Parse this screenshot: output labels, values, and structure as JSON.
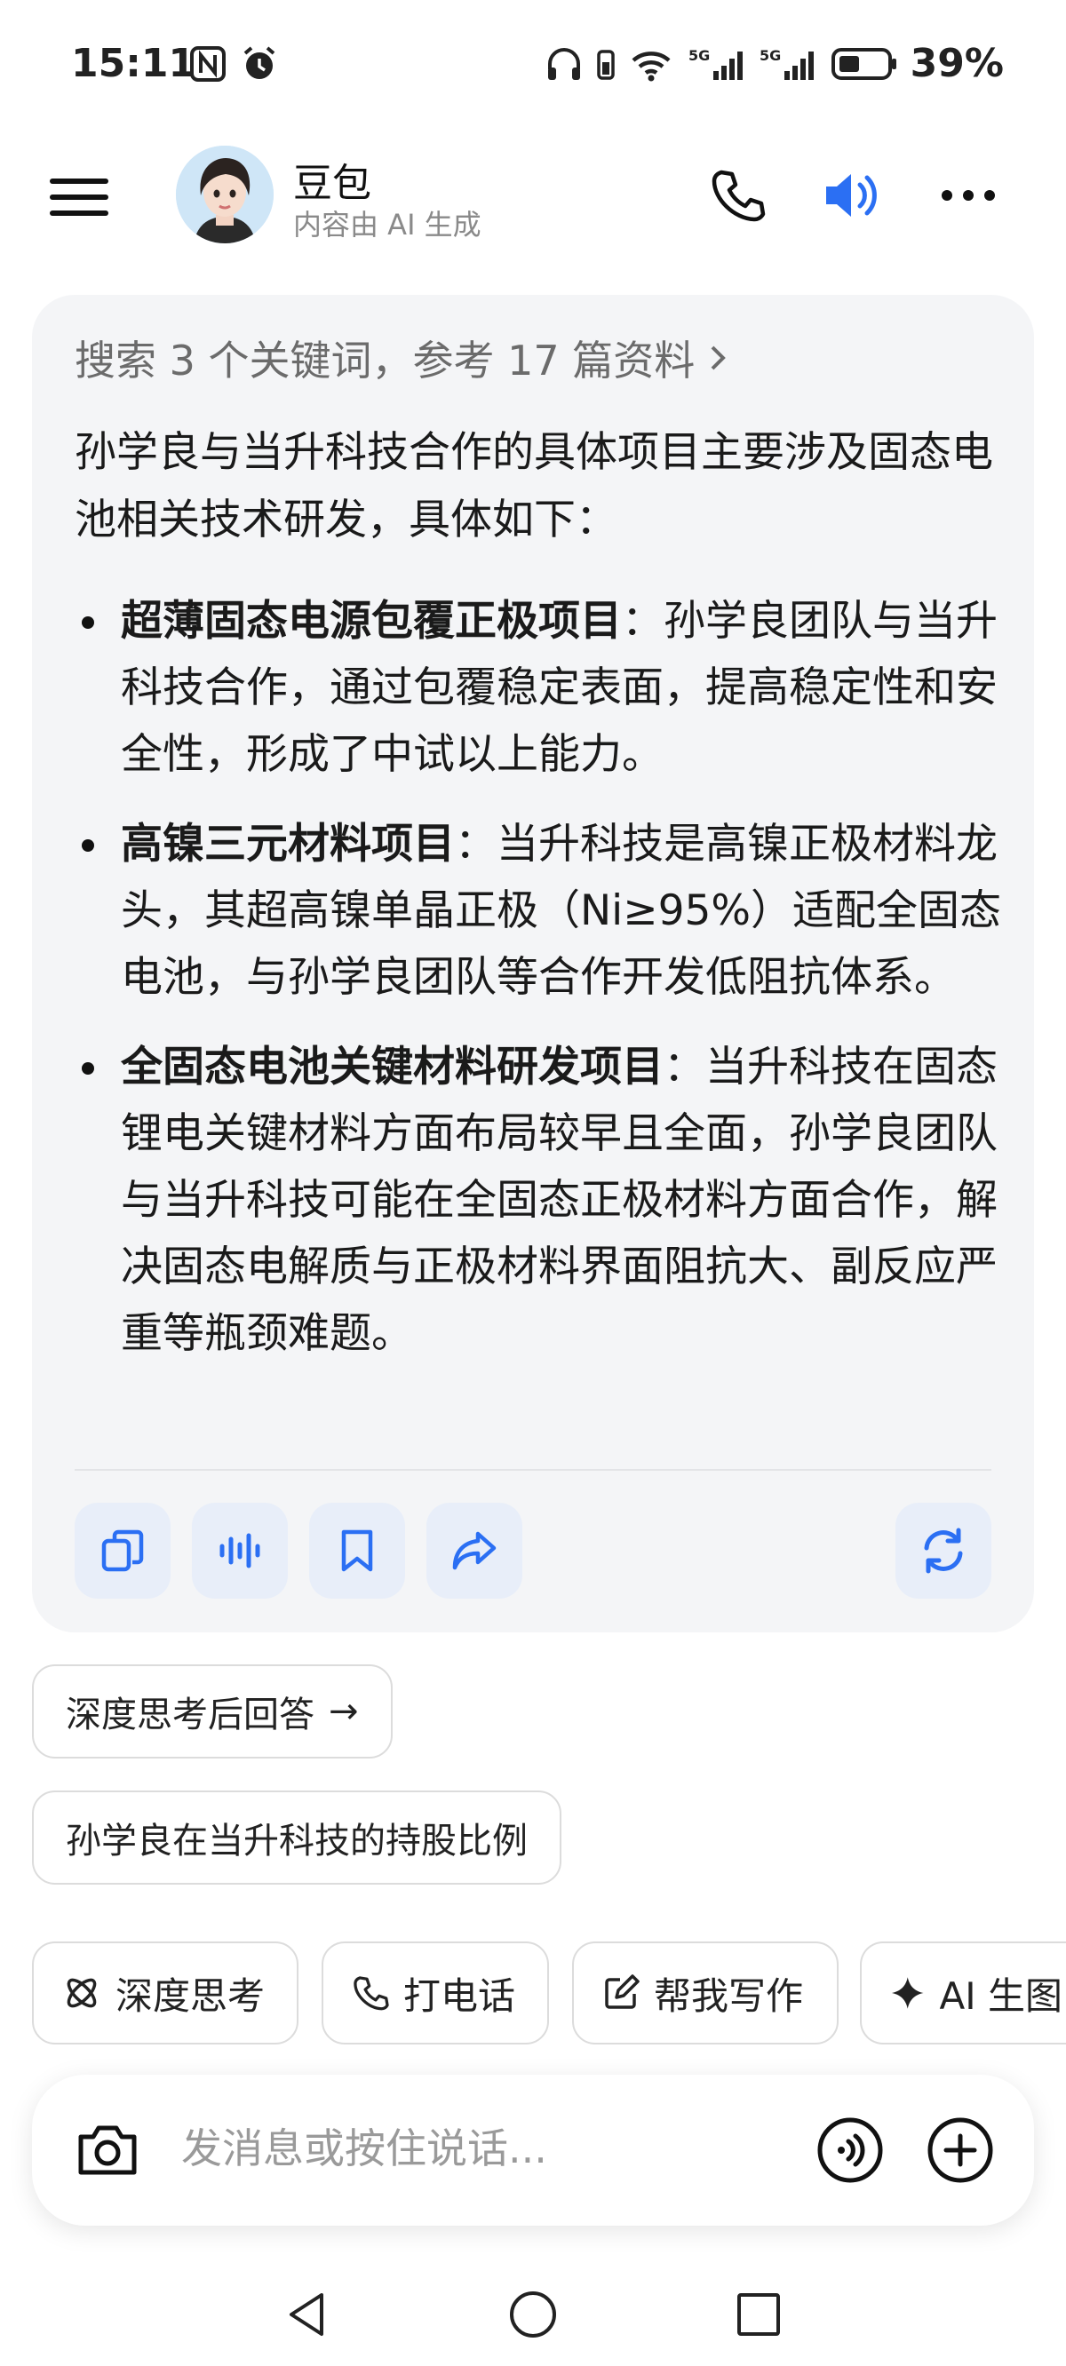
{
  "status_bar": {
    "time": "15:11",
    "battery": "39%",
    "network_1": "5G",
    "network_2": "5G",
    "wifi_badge": "6"
  },
  "header": {
    "bot_name": "豆包",
    "bot_subtitle": "内容由 AI 生成",
    "accent_color": "#2b6ff3"
  },
  "answer": {
    "search_summary": "搜索 3 个关键词，参考 17 篇资料",
    "intro": "孙学良与当升科技合作的具体项目主要涉及固态电池相关技术研发，具体如下：",
    "items": [
      {
        "title": "超薄固态电源包覆正极项目",
        "body": "：孙学良团队与当升科技合作，通过包覆稳定表面，提高稳定性和安全性，形成了中试以上能力。"
      },
      {
        "title": "高镍三元材料项目",
        "body": "：当升科技是高镍正极材料龙头，其超高镍单晶正极（Ni≥95%）适配全固态电池，与孙学良团队等合作开发低阻抗体系。"
      },
      {
        "title": "全固态电池关键材料研发项目",
        "body": "：当升科技在固态锂电关键材料方面布局较早且全面，孙学良团队与当升科技可能在全固态正极材料方面合作，解决固态电解质与正极材料界面阻抗大、副反应严重等瓶颈难题。"
      }
    ],
    "actions": [
      "copy-icon",
      "voice-icon",
      "bookmark-icon",
      "share-icon",
      "regenerate-icon"
    ]
  },
  "suggestions": [
    {
      "label": "深度思考后回答",
      "arrow": "→"
    },
    {
      "label": "孙学良在当升科技的持股比例"
    }
  ],
  "quick_actions": [
    {
      "label": "深度思考",
      "icon": "atom-icon"
    },
    {
      "label": "打电话",
      "icon": "phone-icon"
    },
    {
      "label": "帮我写作",
      "icon": "edit-icon"
    },
    {
      "label": "AI 生图",
      "icon": "sparkle-icon"
    }
  ],
  "input": {
    "placeholder": "发消息或按住说话..."
  }
}
